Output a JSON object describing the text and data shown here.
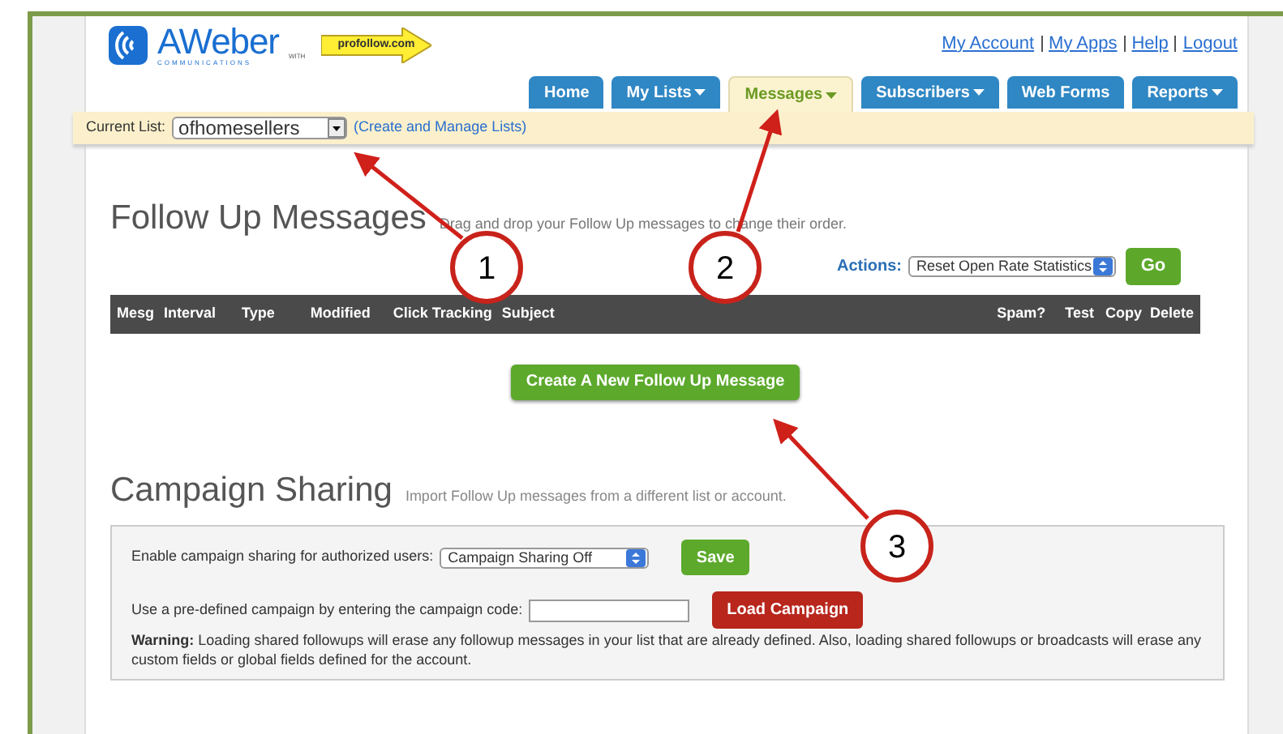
{
  "logo": {
    "brand": "AWeber",
    "tagline": "COMMUNICATIONS",
    "with": "WITH",
    "partner": "profollow.com"
  },
  "top_links": [
    "My Account",
    "My Apps",
    "Help",
    "Logout"
  ],
  "tabs": [
    {
      "label": "Home",
      "dropdown": false,
      "selected": false
    },
    {
      "label": "My Lists",
      "dropdown": true,
      "selected": false
    },
    {
      "label": "Messages",
      "dropdown": true,
      "selected": true
    },
    {
      "label": "Subscribers",
      "dropdown": true,
      "selected": false
    },
    {
      "label": "Web Forms",
      "dropdown": false,
      "selected": false
    },
    {
      "label": "Reports",
      "dropdown": true,
      "selected": false
    }
  ],
  "current_list": {
    "label": "Current List:",
    "value": "ofhomesellers",
    "link": "(Create and Manage Lists)"
  },
  "follow_up": {
    "title": "Follow Up Messages",
    "subtitle": "Drag and drop your Follow Up messages to change their order.",
    "actions_label": "Actions:",
    "actions_value": "Reset Open Rate Statistics",
    "go": "Go",
    "columns": [
      "Mesg",
      "Interval",
      "Type",
      "Modified",
      "Click Tracking",
      "Subject",
      "Spam?",
      "Test",
      "Copy",
      "Delete"
    ],
    "create_button": "Create A New Follow Up Message"
  },
  "campaign_sharing": {
    "title": "Campaign Sharing",
    "subtitle": "Import Follow Up messages from a different list or account.",
    "enable_label": "Enable campaign sharing for authorized users:",
    "enable_value": "Campaign Sharing Off",
    "save": "Save",
    "code_label": "Use a pre-defined campaign by entering the campaign code:",
    "load": "Load Campaign",
    "warning": "**Warning:** Loading shared followups will erase any followup messages in your list that are already defined. Also, loading shared followups or broadcasts will erase any custom fields or global fields defined for the account."
  },
  "annotations": [
    "1",
    "2",
    "3"
  ]
}
